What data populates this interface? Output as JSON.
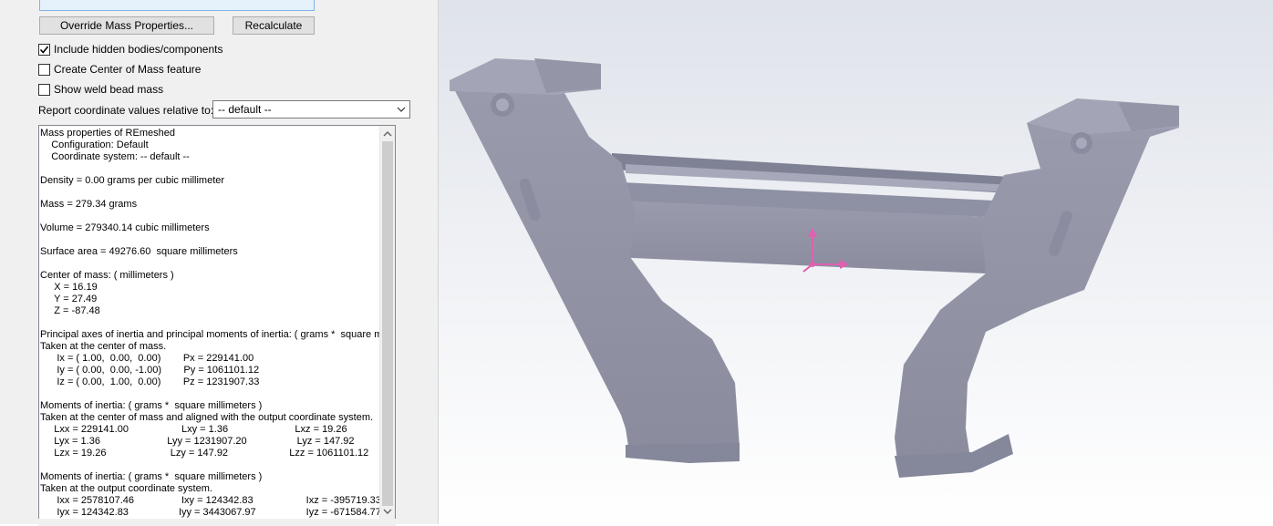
{
  "panel": {
    "override_button": "Override Mass Properties...",
    "recalc_button": "Recalculate",
    "options": [
      {
        "label": "Include hidden bodies/components",
        "checked": true
      },
      {
        "label": "Create Center of Mass feature",
        "checked": false
      },
      {
        "label": "Show weld bead mass",
        "checked": false
      }
    ],
    "coord_label": "Report coordinate values relative to:",
    "coord_value": "-- default --",
    "results_lines": [
      "Mass properties of REmeshed",
      "    Configuration: Default",
      "    Coordinate system: -- default --",
      "",
      "Density = 0.00 grams per cubic millimeter",
      "",
      "Mass = 279.34 grams",
      "",
      "Volume = 279340.14 cubic millimeters",
      "",
      "Surface area = 49276.60  square millimeters",
      "",
      "Center of mass: ( millimeters )",
      "     X = 16.19",
      "     Y = 27.49",
      "     Z = -87.48",
      "",
      "Principal axes of inertia and principal moments of inertia: ( grams *  square millimeters )",
      "Taken at the center of mass.",
      "      Ix = ( 1.00,  0.00,  0.00)        Px = 229141.00",
      "      Iy = ( 0.00,  0.00, -1.00)        Py = 1061101.12",
      "      Iz = ( 0.00,  1.00,  0.00)        Pz = 1231907.33",
      "",
      "Moments of inertia: ( grams *  square millimeters )",
      "Taken at the center of mass and aligned with the output coordinate system.",
      "     Lxx = 229141.00                   Lxy = 1.36                        Lxz = 19.26",
      "     Lyx = 1.36                        Lyy = 1231907.20                  Lyz = 147.92",
      "     Lzx = 19.26                       Lzy = 147.92                      Lzz = 1061101.12",
      "",
      "Moments of inertia: ( grams *  square millimeters )",
      "Taken at the output coordinate system.",
      "      Ixx = 2578107.46                 Ixy = 124342.83                   Ixz = -395719.33",
      "      Iyx = 124342.83                  Iyy = 3443067.97                  Iyz = -671584.77"
    ]
  },
  "viewport": {
    "part_color": "#9597a9",
    "triad_color": "#e060b0"
  }
}
